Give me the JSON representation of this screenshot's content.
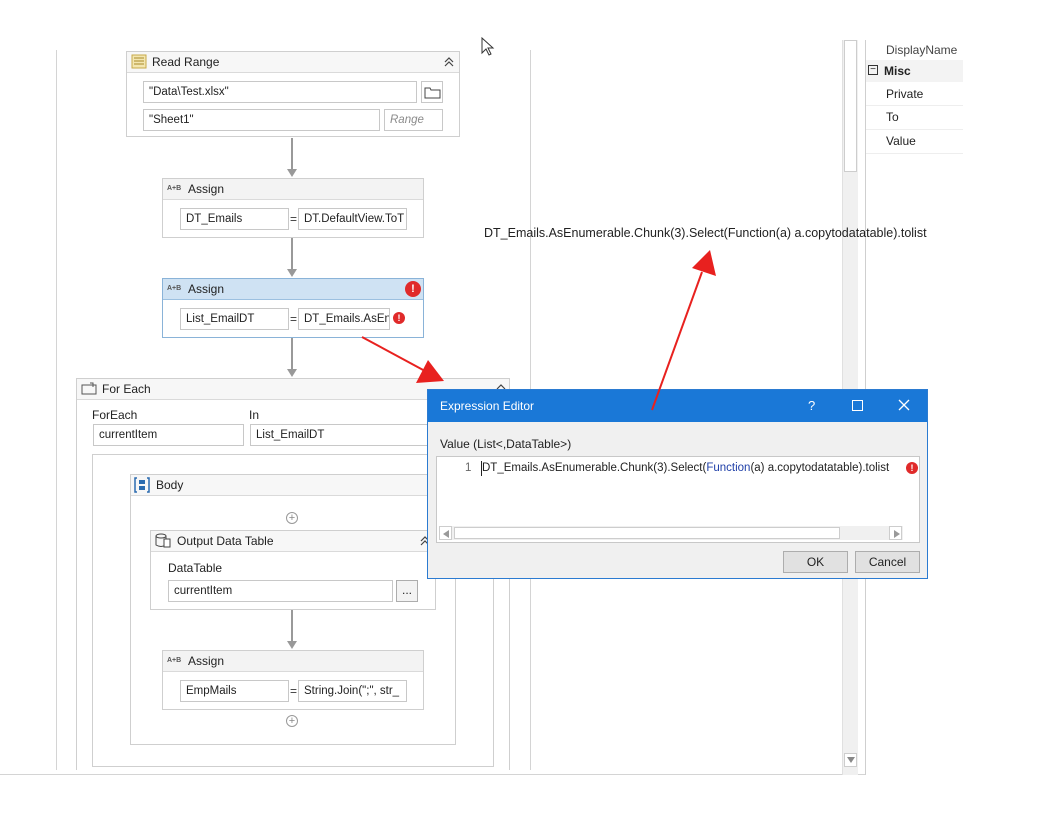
{
  "read_range": {
    "title": "Read Range",
    "workbook_path": "\"Data\\Test.xlsx\"",
    "sheet_name": "\"Sheet1\"",
    "range_placeholder": "Range"
  },
  "assign1": {
    "title": "Assign",
    "to": "DT_Emails",
    "value": "DT.DefaultView.ToT"
  },
  "assign2": {
    "title": "Assign",
    "to": "List_EmailDT",
    "value": "DT_Emails.AsEn"
  },
  "for_each": {
    "title": "For Each",
    "foreach_label": "ForEach",
    "in_label": "In",
    "item": "currentItem",
    "collection": "List_EmailDT"
  },
  "body": {
    "title": "Body"
  },
  "output_dt": {
    "title": "Output Data Table",
    "datatable_label": "DataTable",
    "datatable_value": "currentItem",
    "browse_label": "..."
  },
  "assign3": {
    "title": "Assign",
    "to": "EmpMails",
    "value": "String.Join(\";\",  str_"
  },
  "annotation": "DT_Emails.AsEnumerable.Chunk(3).Select(Function(a) a.copytodatatable).tolist",
  "properties": {
    "partial_row": "DisplayName",
    "category": "Misc",
    "rows": [
      "Private",
      "To",
      "Value"
    ]
  },
  "dialog": {
    "title": "Expression Editor",
    "help": "?",
    "value_label": "Value (List<,DataTable>)",
    "line_number": "1",
    "code_before": "DT_Emails.AsEnumerable.Chunk(3).Select(",
    "code_keyword": "Function",
    "code_after": "(a) a.copytodatatable).tolist",
    "ok_label": "OK",
    "cancel_label": "Cancel"
  },
  "colors": {
    "dialog_title": "#1a78d7",
    "selected_header": "#cfe2f3",
    "error": "#e02a2a",
    "annotation_arrow": "#e8211f",
    "keyword": "#1f3fa8"
  }
}
